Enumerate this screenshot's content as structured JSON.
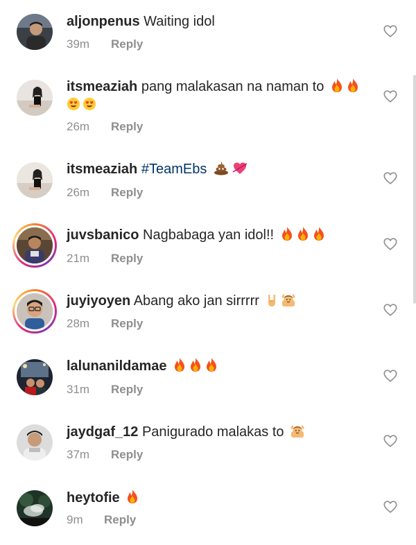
{
  "comments": [
    {
      "username": "aljonpenus",
      "text": "Waiting idol",
      "time": "39m",
      "reply": "Reply",
      "emojis": []
    },
    {
      "username": "itsmeaziah",
      "text": "pang malakasan na naman to",
      "time": "26m",
      "reply": "Reply",
      "emojis": [
        "fire-emoji",
        "fire-emoji"
      ],
      "emojis_line2": [
        "heart-eyes-emoji",
        "heart-eyes-emoji"
      ]
    },
    {
      "username": "itsmeaziah",
      "text": "",
      "hashtag": "#TeamEbs",
      "time": "26m",
      "reply": "Reply",
      "emojis": [
        "poop-emoji",
        "heart-arrow-emoji"
      ]
    },
    {
      "username": "juvsbanico",
      "text": "Nagbabaga yan idol!!",
      "time": "21m",
      "reply": "Reply",
      "emojis": [
        "fire-emoji",
        "fire-emoji",
        "fire-emoji"
      ]
    },
    {
      "username": "juyiyoyen",
      "text": "Abang ako jan sirrrrr",
      "time": "28m",
      "reply": "Reply",
      "emojis": [
        "rock-hand-emoji",
        "person-raising-hands-emoji"
      ]
    },
    {
      "username": "lalunanildamae",
      "text": "",
      "time": "31m",
      "reply": "Reply",
      "emojis": [
        "fire-emoji",
        "fire-emoji",
        "fire-emoji"
      ]
    },
    {
      "username": "jaydgaf_12",
      "text": "Panigurado malakas to",
      "time": "37m",
      "reply": "Reply",
      "emojis": [
        "person-raising-hands-emoji"
      ]
    },
    {
      "username": "heytofie",
      "text": "",
      "time": "9m",
      "reply": "Reply",
      "emojis": [
        "fire-emoji"
      ]
    }
  ],
  "colors": {
    "text": "#262626",
    "meta": "#8e8e8e",
    "hashtag": "#003569",
    "fire": "#f4511e"
  }
}
